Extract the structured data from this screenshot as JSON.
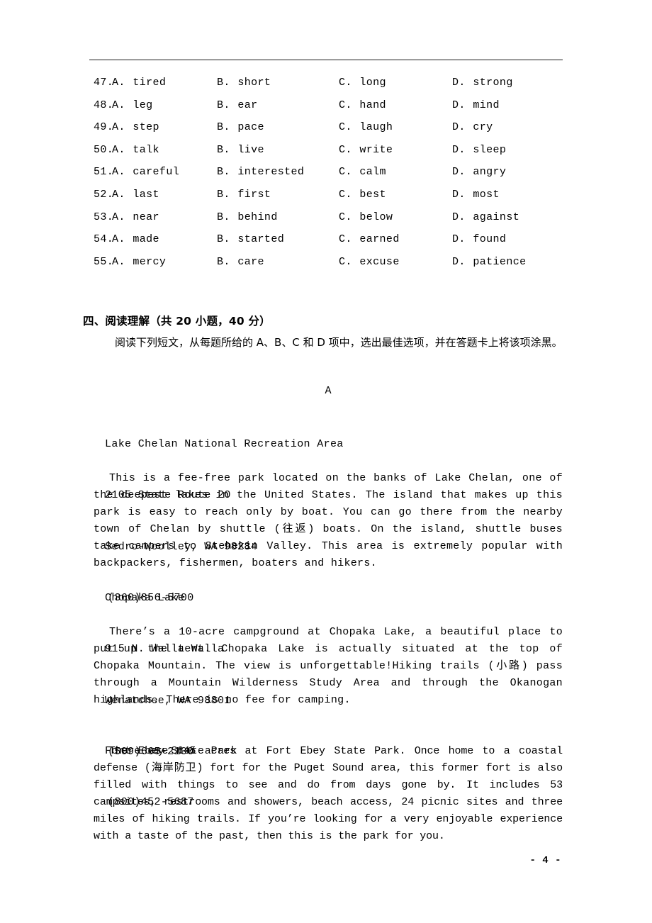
{
  "document": {
    "page_number_label": "- 4 -"
  },
  "cloze_options": {
    "rows": [
      {
        "number": "47.",
        "a_letter": "A.",
        "a": "tired",
        "b_letter": "B.",
        "b": "short",
        "c_letter": "C.",
        "c": "long",
        "d_letter": "D.",
        "d": "strong"
      },
      {
        "number": "48.",
        "a_letter": "A.",
        "a": "leg",
        "b_letter": "B.",
        "b": "ear",
        "c_letter": "C.",
        "c": "hand",
        "d_letter": "D.",
        "d": "mind"
      },
      {
        "number": "49.",
        "a_letter": "A.",
        "a": "step",
        "b_letter": "B.",
        "b": "pace",
        "c_letter": "C.",
        "c": "laugh",
        "d_letter": "D.",
        "d": "cry"
      },
      {
        "number": "50.",
        "a_letter": "A.",
        "a": "talk",
        "b_letter": "B.",
        "b": "live",
        "c_letter": "C.",
        "c": "write",
        "d_letter": "D.",
        "d": "sleep"
      },
      {
        "number": "51.",
        "a_letter": "A.",
        "a": "careful",
        "b_letter": "B.",
        "b": "interested",
        "c_letter": "C.",
        "c": "calm",
        "d_letter": "D.",
        "d": "angry"
      },
      {
        "number": "52.",
        "a_letter": "A.",
        "a": "last",
        "b_letter": "B.",
        "b": "first",
        "c_letter": "C.",
        "c": "best",
        "d_letter": "D.",
        "d": "most"
      },
      {
        "number": "53.",
        "a_letter": "A.",
        "a": "near",
        "b_letter": "B.",
        "b": "behind",
        "c_letter": "C.",
        "c": "below",
        "d_letter": "D.",
        "d": "against"
      },
      {
        "number": "54.",
        "a_letter": "A.",
        "a": "made",
        "b_letter": "B.",
        "b": "started",
        "c_letter": "C.",
        "c": "earned",
        "d_letter": "D.",
        "d": "found"
      },
      {
        "number": "55.",
        "a_letter": "A.",
        "a": "mercy",
        "b_letter": "B.",
        "b": "care",
        "c_letter": "C.",
        "c": "excuse",
        "d_letter": "D.",
        "d": "patience"
      }
    ]
  },
  "reading_section": {
    "heading": "四、阅读理解（共 20 小题，40 分）",
    "instruction": "阅读下列短文，从每题所给的 A、B、C 和 D 项中，选出最佳选项，并在答题卡上将该项涂黑。",
    "passage_label": "A",
    "entries": [
      {
        "name": "Lake Chelan National Recreation Area",
        "address_line": "2105 State Route 20",
        "city_line": "Sedro-Woolley, WA 98284",
        "phone": "(360)856-5700",
        "body": "This is a fee-free park located on the banks of Lake Chelan, one of the deepest lakes in the United States. The island that makes up this park is easy to reach only by boat. You can go there from the nearby town of Chelan by shuttle (往返) boats. On the island, shuttle buses take campers to Stehekin Valley. This area is extremely popular with backpackers, fishermen, boaters and hikers."
      },
      {
        "name": "Chopaka Lake",
        "address_line": "915 N. Walla Walla",
        "city_line": "Wenatchee, WA 98801",
        "phone": "(509)665-2100",
        "body": "There’s a 10-acre campground at Chopaka Lake, a beautiful place to put up the tent. Chopaka Lake is actually situated at the top of Chopaka Mountain. The view is unforgettable!Hiking trails (小路) pass through a Mountain Wilderness Study Area and through the Okanogan highlands. There is no fee for camping."
      },
      {
        "name": "Fort Ebey State Park",
        "phone": "(800)452-5687",
        "body": "There are 645 acres at Fort Ebey State Park. Once home to a coastal defense (海岸防卫) fort for the Puget Sound area, this former fort is also filled with things to see and do from days gone by. It includes 53 campsites, restrooms and showers, beach access, 24 picnic sites and three miles of hiking trails. If you’re looking for a very enjoyable experience with a taste of the past, then this is the park for you."
      }
    ]
  }
}
